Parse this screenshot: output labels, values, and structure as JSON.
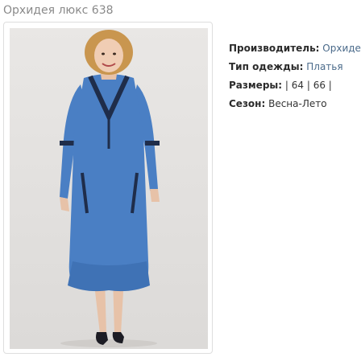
{
  "product": {
    "title": "Орхидея люкс 638",
    "image_alt": "Платье синее, модель в полный рост"
  },
  "specs": {
    "manufacturer": {
      "label": "Производитель:",
      "value": "Орхидея"
    },
    "clothing_type": {
      "label": "Тип одежды:",
      "value": "Платья"
    },
    "sizes": {
      "label": "Размеры:",
      "value": "| 64 | 66 |"
    },
    "season": {
      "label": "Сезон:",
      "value": "Весна-Лето"
    }
  },
  "colors": {
    "title": "#8a8a8a",
    "link": "#4a6a8a",
    "dress": "#4a7fc4",
    "background": "#e4e2e0"
  }
}
